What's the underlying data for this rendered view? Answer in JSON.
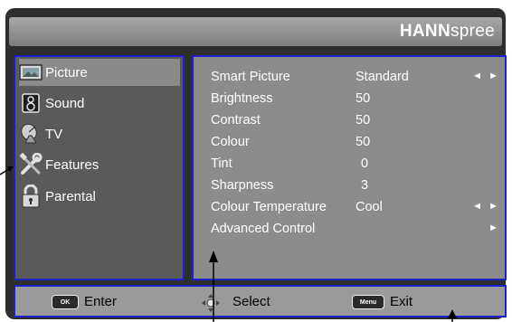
{
  "brand": {
    "bold": "HANN",
    "light": "spree"
  },
  "sidebar": {
    "items": [
      {
        "label": "Picture",
        "icon": "picture-icon",
        "selected": true
      },
      {
        "label": "Sound",
        "icon": "speaker-icon",
        "selected": false
      },
      {
        "label": "TV",
        "icon": "satellite-dish-icon",
        "selected": false
      },
      {
        "label": "Features",
        "icon": "tools-icon",
        "selected": false
      },
      {
        "label": "Parental",
        "icon": "lock-icon",
        "selected": false
      }
    ]
  },
  "settings": [
    {
      "label": "Smart Picture",
      "value": "Standard",
      "arrows": "◄ ►"
    },
    {
      "label": "Brightness",
      "value": "50",
      "arrows": ""
    },
    {
      "label": "Contrast",
      "value": "50",
      "arrows": ""
    },
    {
      "label": "Colour",
      "value": "50",
      "arrows": ""
    },
    {
      "label": "Tint",
      "value": "  0",
      "arrows": ""
    },
    {
      "label": "Sharpness",
      "value": "  3",
      "arrows": ""
    },
    {
      "label": "Colour Temperature",
      "value": "Cool",
      "arrows": "◄ ►"
    },
    {
      "label": "Advanced Control",
      "value": "",
      "arrows": "►"
    }
  ],
  "footer": {
    "ok_key": "OK",
    "enter_label": "Enter",
    "select_label": "Select",
    "menu_key": "Menu",
    "exit_label": "Exit"
  },
  "colors": {
    "highlight_border": "#1e22c8",
    "panel_bg": "#8c8c8c",
    "sidebar_bg": "#5a5a5a"
  }
}
